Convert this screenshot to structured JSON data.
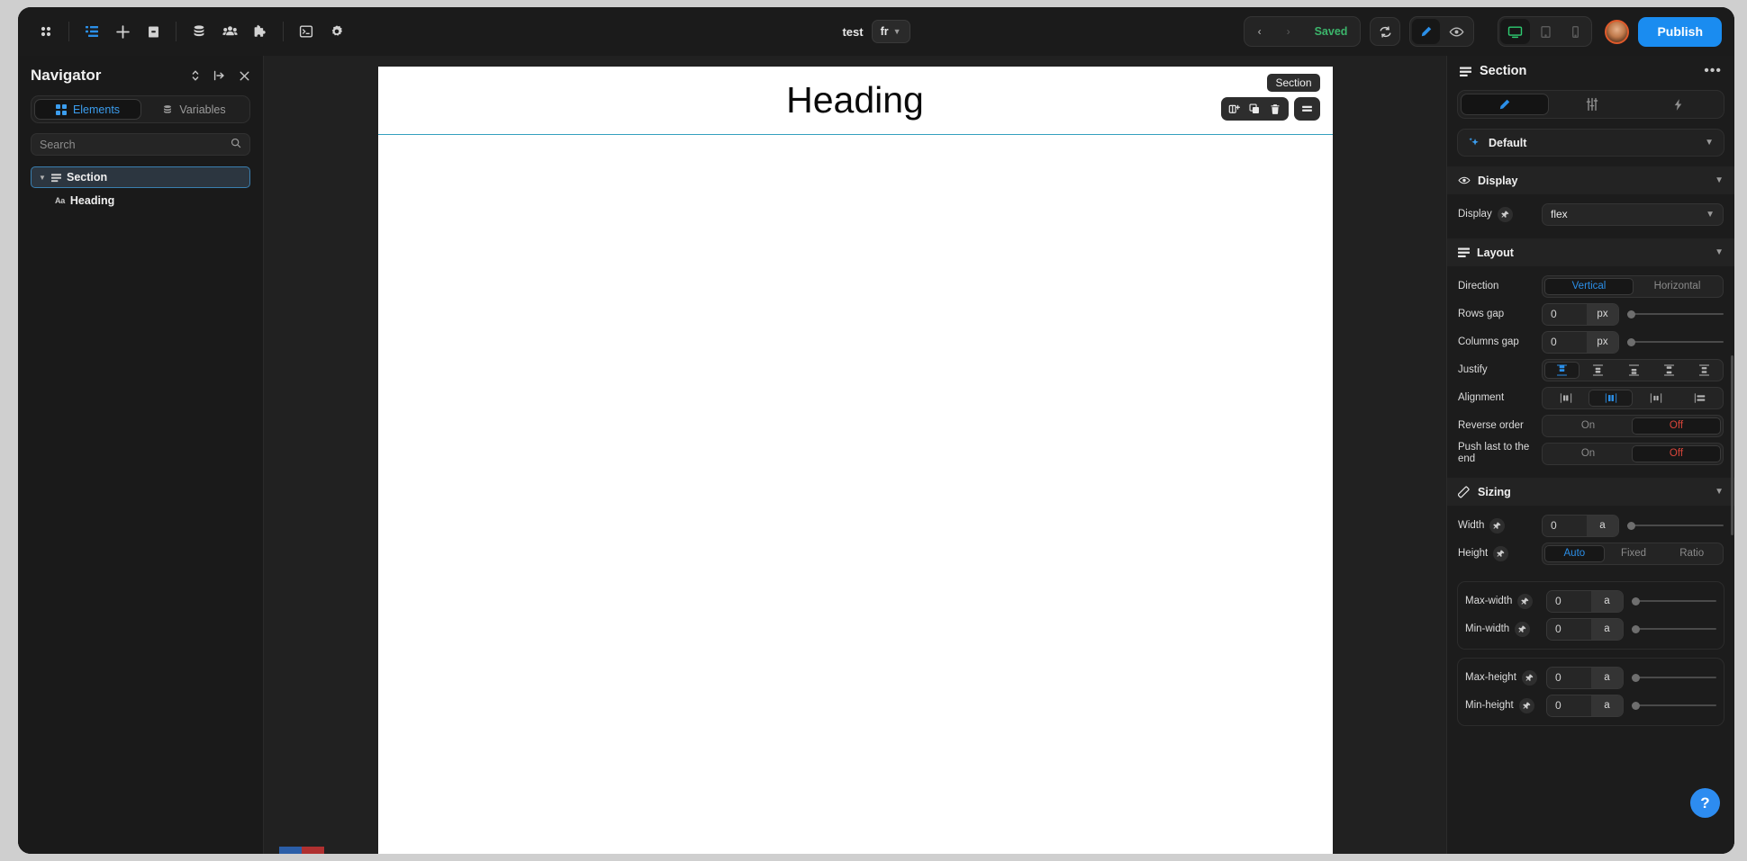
{
  "topbar": {
    "left_icons": [
      {
        "name": "apps-grid-icon",
        "glyph": "grid"
      },
      {
        "name": "navigator-panel-icon",
        "glyph": "tree",
        "active": true
      },
      {
        "name": "add-element-icon",
        "glyph": "plus"
      },
      {
        "name": "pages-icon",
        "glyph": "page"
      },
      {
        "name": "database-icon",
        "glyph": "db"
      },
      {
        "name": "users-icon",
        "glyph": "users"
      },
      {
        "name": "plugins-icon",
        "glyph": "puzzle"
      },
      {
        "name": "code-icon",
        "glyph": "code"
      },
      {
        "name": "settings-icon",
        "glyph": "gear"
      }
    ],
    "project_name": "test",
    "language": "fr",
    "history_prev": "‹",
    "history_next": "›",
    "save_status": "Saved",
    "refresh_label": "refresh-icon",
    "edit_mode": "edit-pencil-icon",
    "preview_mode": "eye-icon",
    "devices": [
      {
        "name": "desktop-view",
        "selected": true
      },
      {
        "name": "tablet-view",
        "selected": false
      },
      {
        "name": "mobile-view",
        "selected": false
      }
    ],
    "publish_label": "Publish",
    "accent_blue": "#1a8cf0",
    "saved_green": "#3cb56b"
  },
  "navigator": {
    "title": "Navigator",
    "head_icons": [
      {
        "name": "sort-toggle-icon"
      },
      {
        "name": "collapse-all-icon"
      },
      {
        "name": "close-panel-icon"
      }
    ],
    "tabs": [
      {
        "label": "Elements",
        "active": true
      },
      {
        "label": "Variables",
        "active": false
      }
    ],
    "search_placeholder": "Search",
    "search_value": "",
    "tree": [
      {
        "label": "Section",
        "depth": 0,
        "selected": true,
        "expanded": true
      },
      {
        "label": "Heading",
        "depth": 1,
        "selected": false
      }
    ]
  },
  "canvas": {
    "heading_text": "Heading",
    "selection_badge": "Section",
    "tools": [
      {
        "name": "add-child-icon"
      },
      {
        "name": "duplicate-icon"
      },
      {
        "name": "delete-icon"
      },
      {
        "name": "layout-options-icon"
      }
    ],
    "selection_color": "#35a0bf"
  },
  "inspector": {
    "title": "Section",
    "more_label": "•••",
    "tabs": [
      {
        "name": "style-tab",
        "active": true
      },
      {
        "name": "settings-tab",
        "active": false
      },
      {
        "name": "interactions-tab",
        "active": false
      }
    ],
    "state_selector": "Default",
    "sections": [
      {
        "id": "display",
        "title": "Display",
        "icon": "eye-icon",
        "rows": [
          {
            "label": "Display",
            "type": "select",
            "value": "flex",
            "pin": true
          }
        ]
      },
      {
        "id": "layout",
        "title": "Layout",
        "icon": "layout-icon",
        "rows": [
          {
            "label": "Direction",
            "type": "toggle",
            "options": [
              "Vertical",
              "Horizontal"
            ],
            "selected": "Vertical"
          },
          {
            "label": "Rows gap",
            "type": "number",
            "value": "0",
            "unit": "px",
            "slider": 0
          },
          {
            "label": "Columns gap",
            "type": "number",
            "value": "0",
            "unit": "px",
            "slider": 0
          },
          {
            "label": "Justify",
            "type": "iconrow",
            "count": 5,
            "selected": 0
          },
          {
            "label": "Alignment",
            "type": "iconrow",
            "count": 4,
            "selected": 1
          },
          {
            "label": "Reverse order",
            "type": "onoff",
            "options": [
              "On",
              "Off"
            ],
            "selected": "Off"
          },
          {
            "label": "Push last to the end",
            "type": "onoff",
            "options": [
              "On",
              "Off"
            ],
            "selected": "Off"
          }
        ]
      },
      {
        "id": "sizing",
        "title": "Sizing",
        "icon": "ruler-icon",
        "rows": [
          {
            "label": "Width",
            "type": "number",
            "value": "0",
            "unit": "a",
            "slider": 0,
            "pin": true
          },
          {
            "label": "Height",
            "type": "toggle3",
            "options": [
              "Auto",
              "Fixed",
              "Ratio"
            ],
            "selected": "Auto",
            "pin": true
          }
        ],
        "subcards": [
          {
            "rows": [
              {
                "label": "Max-width",
                "type": "number",
                "value": "0",
                "unit": "a",
                "slider": 0,
                "pin": true
              },
              {
                "label": "Min-width",
                "type": "number",
                "value": "0",
                "unit": "a",
                "slider": 0,
                "pin": true
              }
            ]
          },
          {
            "rows": [
              {
                "label": "Max-height",
                "type": "number",
                "value": "0",
                "unit": "a",
                "slider": 0,
                "pin": true
              },
              {
                "label": "Min-height",
                "type": "number",
                "value": "0",
                "unit": "a",
                "slider": 0,
                "pin": true
              }
            ]
          }
        ]
      }
    ],
    "help_label": "?"
  }
}
